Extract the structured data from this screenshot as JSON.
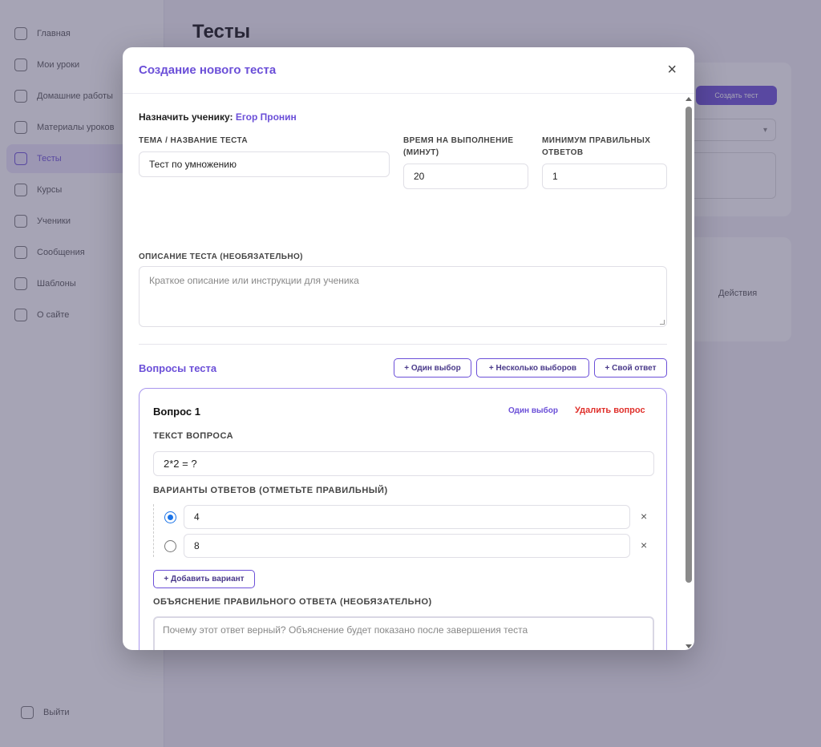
{
  "sidebar": {
    "items": [
      {
        "label": "Главная",
        "icon": "home-icon"
      },
      {
        "label": "Мои уроки",
        "icon": "calendar-icon"
      },
      {
        "label": "Домашние работы",
        "icon": "homework-icon"
      },
      {
        "label": "Материалы уроков",
        "icon": "folder-icon"
      },
      {
        "label": "Тесты",
        "icon": "test-icon",
        "active": true
      },
      {
        "label": "Курсы",
        "icon": "courses-icon"
      },
      {
        "label": "Ученики",
        "icon": "users-icon"
      },
      {
        "label": "Сообщения",
        "icon": "messages-icon"
      },
      {
        "label": "Шаблоны",
        "icon": "templates-icon"
      },
      {
        "label": "О сайте",
        "icon": "info-icon"
      }
    ],
    "logout": "Выйти"
  },
  "page": {
    "title": "Тесты",
    "create_button": "Создать тест",
    "actions_label": "Действия"
  },
  "modal": {
    "title": "Создание нового теста",
    "assign_label": "Назначить ученику:",
    "student_name": "Егор Пронин",
    "topic_label": "Тема / название теста",
    "topic_value": "Тест по умножению",
    "time_label_1": "Время на выполнение",
    "time_label_2": "(минут)",
    "time_value": "20",
    "min_label_1": "Минимум правильных",
    "min_label_2": "ответов",
    "min_value": "1",
    "description_label": "Описание теста (необязательно)",
    "description_placeholder": "Краткое описание или инструкции для ученика",
    "questions_title": "Вопросы теста",
    "add_single": "+ Один выбор",
    "add_multiple": "+ Несколько выборов",
    "add_custom": "+ Свой ответ",
    "question": {
      "title": "Вопрос 1",
      "type": "Один выбор",
      "delete": "Удалить вопрос",
      "text_label": "Текст вопроса",
      "text_value": "2*2 = ?",
      "options_label": "Варианты ответов (отметьте правильный)",
      "options": [
        {
          "value": "4",
          "correct": true
        },
        {
          "value": "8",
          "correct": false
        }
      ],
      "remove_option": "×",
      "add_option": "+ Добавить вариант",
      "explanation_label": "Объяснение правильного ответа (необязательно)",
      "explanation_placeholder": "Почему этот ответ верный? Объяснение будет показано после завершения теста"
    },
    "close_symbol": "×"
  },
  "colors": {
    "accent": "#6b4fd8",
    "danger": "#e0302b",
    "radio": "#1a73e8"
  }
}
